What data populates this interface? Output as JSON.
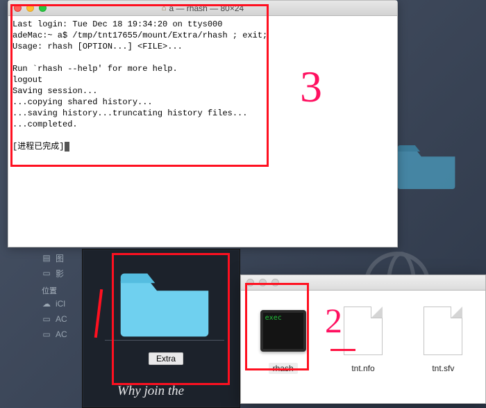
{
  "terminal": {
    "title": "a — rhash — 80×24",
    "lines": [
      "Last login: Tue Dec 18 19:34:20 on ttys000",
      "adeMac:~ a$ /tmp/tnt17655/mount/Extra/rhash ; exit;",
      "Usage: rhash [OPTION...] <FILE>...",
      "",
      "Run `rhash --help' for more help.",
      "logout",
      "Saving session...",
      "...copying shared history...",
      "...saving history...truncating history files...",
      "...completed.",
      "",
      "[进程已完成]"
    ]
  },
  "sidebar": {
    "items": [
      {
        "icon": "▤",
        "label": "图"
      },
      {
        "icon": "▭",
        "label": "影"
      }
    ],
    "heading": "位置",
    "places": [
      {
        "icon": "☁",
        "label": "iCl"
      },
      {
        "icon": "▭",
        "label": "AC"
      },
      {
        "icon": "▭",
        "label": "AC"
      }
    ]
  },
  "disk": {
    "folder_label": "Extra",
    "tagline": "Why join the"
  },
  "files_window": {
    "items": [
      {
        "name": "rhash",
        "kind": "exec",
        "exec_tag": "exec",
        "selected": true
      },
      {
        "name": "tnt.nfo",
        "kind": "doc",
        "selected": false
      },
      {
        "name": "tnt.sfv",
        "kind": "doc",
        "selected": false
      }
    ]
  },
  "annotations": {
    "n3": "3",
    "n2": "2"
  }
}
